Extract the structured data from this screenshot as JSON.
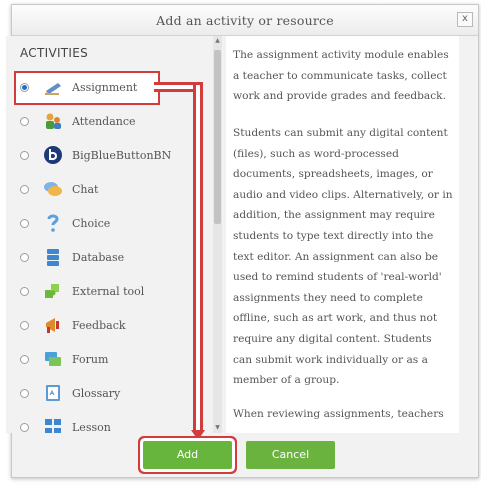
{
  "dialog": {
    "title": "Add an activity or resource",
    "close_label": "x"
  },
  "left": {
    "section_header": "ACTIVITIES",
    "selected_index": 0,
    "items": [
      {
        "label": "Assignment",
        "icon": "assignment-icon",
        "selected": true
      },
      {
        "label": "Attendance",
        "icon": "attendance-icon",
        "selected": false
      },
      {
        "label": "BigBlueButtonBN",
        "icon": "bigbluebutton-icon",
        "selected": false
      },
      {
        "label": "Chat",
        "icon": "chat-icon",
        "selected": false
      },
      {
        "label": "Choice",
        "icon": "choice-icon",
        "selected": false
      },
      {
        "label": "Database",
        "icon": "database-icon",
        "selected": false
      },
      {
        "label": "External tool",
        "icon": "external-tool-icon",
        "selected": false
      },
      {
        "label": "Feedback",
        "icon": "feedback-icon",
        "selected": false
      },
      {
        "label": "Forum",
        "icon": "forum-icon",
        "selected": false
      },
      {
        "label": "Glossary",
        "icon": "glossary-icon",
        "selected": false
      },
      {
        "label": "Lesson",
        "icon": "lesson-icon",
        "selected": false
      }
    ]
  },
  "description": {
    "paragraphs": [
      "The assignment activity module enables a teacher to communicate tasks, collect work and provide grades and feedback.",
      "Students can submit any digital content (files), such as word-processed documents, spreadsheets, images, or audio and video clips. Alternatively, or in addition, the assignment may require students to type text directly into the text editor. An assignment can also be used to remind students of 'real-world' assignments they need to complete offline, such as art work, and thus not require any digital content. Students can submit work individually or as a member of a group.",
      "When reviewing assignments, teachers"
    ]
  },
  "footer": {
    "add_label": "Add",
    "cancel_label": "Cancel"
  },
  "colors": {
    "button_green": "#68b53d",
    "highlight_red": "#d23c3c",
    "radio_selected": "#1a6fd1"
  }
}
